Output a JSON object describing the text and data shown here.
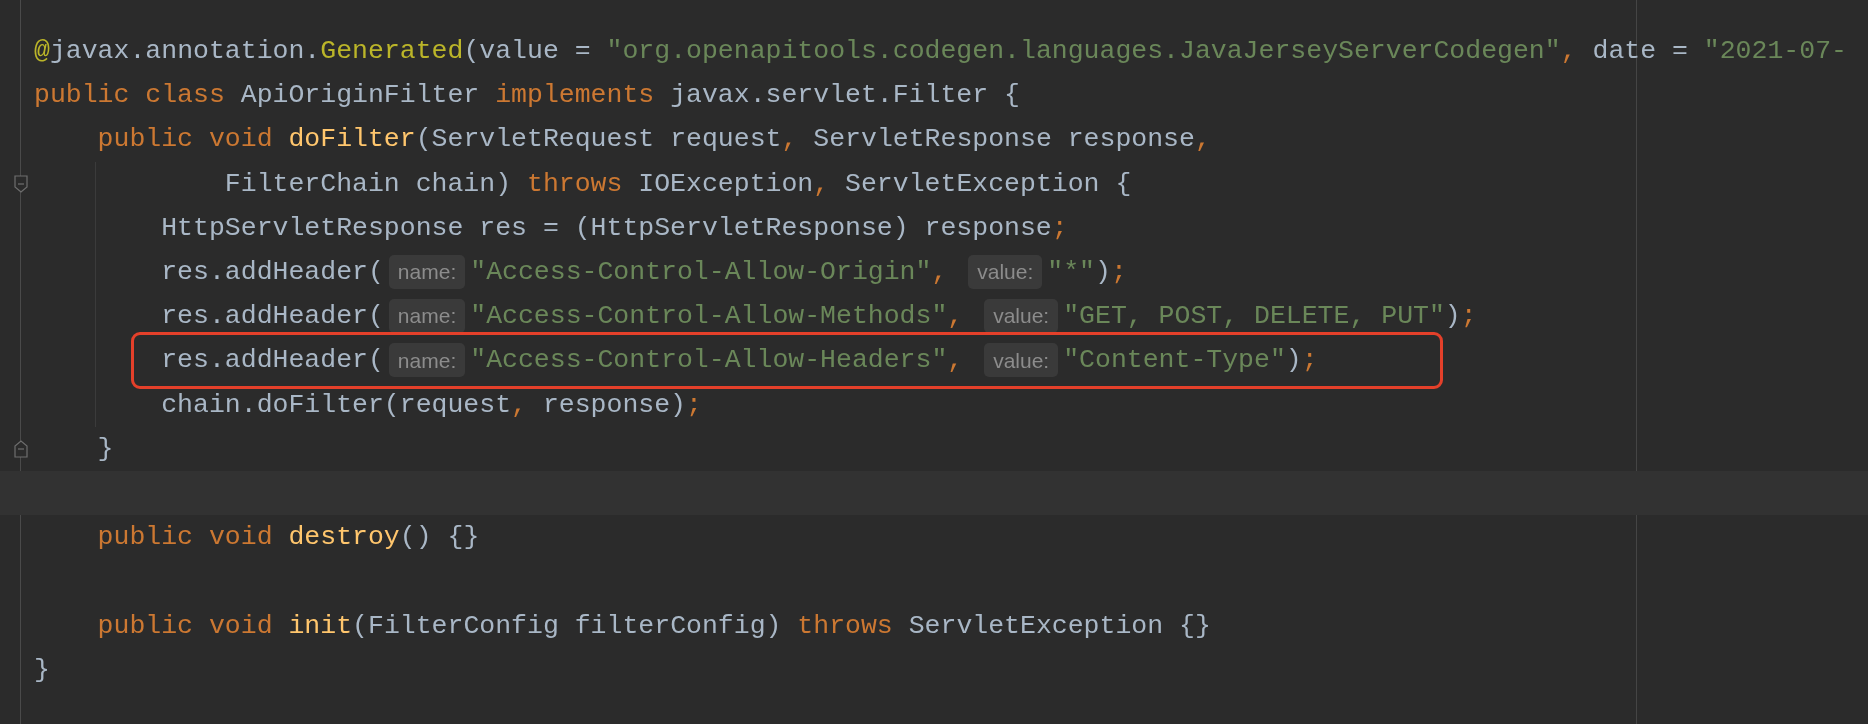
{
  "editor": {
    "lines": [
      {
        "current": false,
        "boxed": false,
        "fold_start": false,
        "fold_end": false,
        "tokens": [
          {
            "kind": "annotation",
            "text": "@"
          },
          {
            "kind": "plain",
            "text": "javax.annotation."
          },
          {
            "kind": "annotation",
            "text": "Generated"
          },
          {
            "kind": "plain",
            "text": "(value = "
          },
          {
            "kind": "string",
            "text": "\"org.openapitools.codegen.languages.JavaJerseyServerCodegen\""
          },
          {
            "kind": "punct",
            "text": ","
          },
          {
            "kind": "plain",
            "text": " date = "
          },
          {
            "kind": "string",
            "text": "\"2021-07-"
          }
        ]
      },
      {
        "current": false,
        "boxed": false,
        "fold_start": false,
        "fold_end": false,
        "tokens": [
          {
            "kind": "keyword",
            "text": "public class "
          },
          {
            "kind": "plain",
            "text": "ApiOriginFilter "
          },
          {
            "kind": "keyword",
            "text": "implements "
          },
          {
            "kind": "plain",
            "text": "javax.servlet.Filter {"
          }
        ]
      },
      {
        "current": false,
        "boxed": false,
        "fold_start": false,
        "fold_end": false,
        "tokens": [
          {
            "kind": "keyword",
            "text": "    public void "
          },
          {
            "kind": "function",
            "text": "doFilter"
          },
          {
            "kind": "plain",
            "text": "(ServletRequest request"
          },
          {
            "kind": "punct",
            "text": ", "
          },
          {
            "kind": "plain",
            "text": "ServletResponse response"
          },
          {
            "kind": "punct",
            "text": ","
          }
        ]
      },
      {
        "current": false,
        "boxed": false,
        "fold_start": true,
        "fold_end": false,
        "tokens": [
          {
            "kind": "plain",
            "text": "            FilterChain chain) "
          },
          {
            "kind": "keyword",
            "text": "throws "
          },
          {
            "kind": "plain",
            "text": "IOException"
          },
          {
            "kind": "punct",
            "text": ", "
          },
          {
            "kind": "plain",
            "text": "ServletException {"
          }
        ]
      },
      {
        "current": false,
        "boxed": false,
        "fold_start": false,
        "fold_end": false,
        "tokens": [
          {
            "kind": "plain",
            "text": "        HttpServletResponse res = (HttpServletResponse) response"
          },
          {
            "kind": "punct",
            "text": ";"
          }
        ]
      },
      {
        "current": false,
        "boxed": false,
        "fold_start": false,
        "fold_end": false,
        "tokens": [
          {
            "kind": "plain",
            "text": "        res.addHeader("
          },
          {
            "kind": "hint",
            "text": "name:"
          },
          {
            "kind": "string",
            "text": "\"Access-Control-Allow-Origin\""
          },
          {
            "kind": "punct",
            "text": ", "
          },
          {
            "kind": "hint",
            "text": "value:"
          },
          {
            "kind": "string",
            "text": "\"*\""
          },
          {
            "kind": "plain",
            "text": ")"
          },
          {
            "kind": "punct",
            "text": ";"
          }
        ]
      },
      {
        "current": false,
        "boxed": false,
        "fold_start": false,
        "fold_end": false,
        "tokens": [
          {
            "kind": "plain",
            "text": "        res.addHeader("
          },
          {
            "kind": "hint",
            "text": "name:"
          },
          {
            "kind": "string",
            "text": "\"Access-Control-Allow-Methods\""
          },
          {
            "kind": "punct",
            "text": ", "
          },
          {
            "kind": "hint",
            "text": "value:"
          },
          {
            "kind": "string",
            "text": "\"GET, POST, DELETE, PUT\""
          },
          {
            "kind": "plain",
            "text": ")"
          },
          {
            "kind": "punct",
            "text": ";"
          }
        ]
      },
      {
        "current": false,
        "boxed": true,
        "fold_start": false,
        "fold_end": false,
        "tokens": [
          {
            "kind": "plain",
            "text": "        res.addHeader("
          },
          {
            "kind": "hint",
            "text": "name:"
          },
          {
            "kind": "string",
            "text": "\"Access-Control-Allow-Headers\""
          },
          {
            "kind": "punct",
            "text": ", "
          },
          {
            "kind": "hint",
            "text": "value:"
          },
          {
            "kind": "string",
            "text": "\"Content-Type\""
          },
          {
            "kind": "plain",
            "text": ")"
          },
          {
            "kind": "punct",
            "text": ";"
          }
        ]
      },
      {
        "current": false,
        "boxed": false,
        "fold_start": false,
        "fold_end": false,
        "tokens": [
          {
            "kind": "plain",
            "text": "        chain.doFilter(request"
          },
          {
            "kind": "punct",
            "text": ", "
          },
          {
            "kind": "plain",
            "text": "response)"
          },
          {
            "kind": "punct",
            "text": ";"
          }
        ]
      },
      {
        "current": false,
        "boxed": false,
        "fold_start": false,
        "fold_end": true,
        "tokens": [
          {
            "kind": "plain",
            "text": "    }"
          }
        ]
      },
      {
        "current": true,
        "boxed": false,
        "fold_start": false,
        "fold_end": false
      },
      {
        "current": false,
        "boxed": false,
        "fold_start": false,
        "fold_end": false,
        "tokens": [
          {
            "kind": "keyword",
            "text": "    public void "
          },
          {
            "kind": "function",
            "text": "destroy"
          },
          {
            "kind": "plain",
            "text": "() {}"
          }
        ]
      },
      {
        "current": false,
        "boxed": false,
        "fold_start": false,
        "fold_end": false
      },
      {
        "current": false,
        "boxed": false,
        "fold_start": false,
        "fold_end": false,
        "tokens": [
          {
            "kind": "keyword",
            "text": "    public void "
          },
          {
            "kind": "function",
            "text": "init"
          },
          {
            "kind": "plain",
            "text": "(FilterConfig filterConfig) "
          },
          {
            "kind": "keyword",
            "text": "throws "
          },
          {
            "kind": "plain",
            "text": "ServletException {}"
          }
        ]
      },
      {
        "current": false,
        "boxed": false,
        "fold_start": false,
        "fold_end": false,
        "tokens": [
          {
            "kind": "plain",
            "text": "}"
          }
        ]
      }
    ]
  }
}
